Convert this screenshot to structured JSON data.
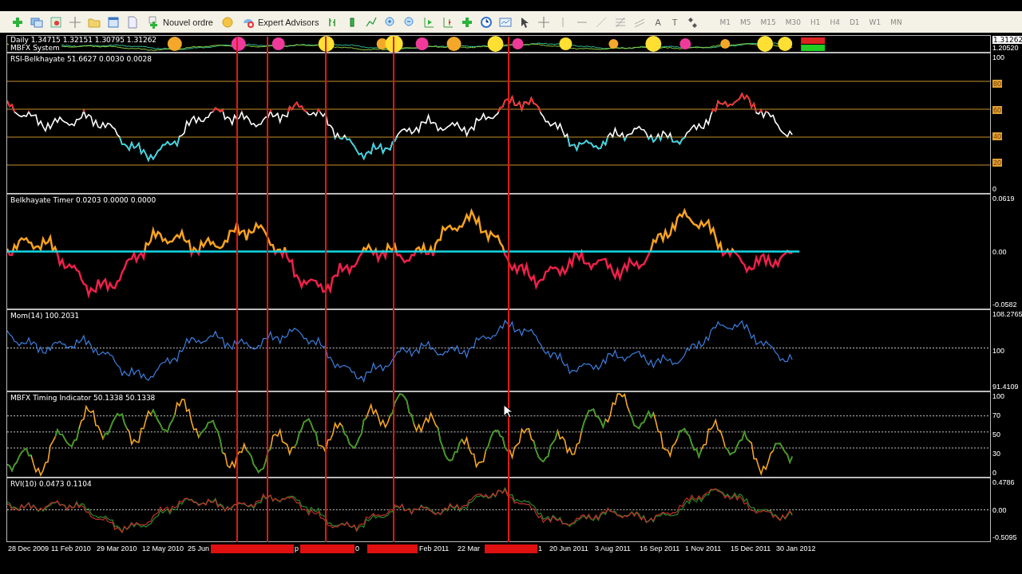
{
  "toolbar": {
    "order_button": "Nouvel ordre",
    "experts_button": "Expert Advisors",
    "text_tools": [
      "A",
      "T"
    ],
    "timeframes": [
      "M1",
      "M5",
      "M15",
      "M30",
      "H1",
      "H4",
      "D1",
      "W1",
      "MN"
    ]
  },
  "chart": {
    "symbol_line": "Daily 1.34715 1.32151 1.30795 1.31262",
    "main_label": "MBFX System",
    "price_current": "1.31262",
    "price_low": "1.20520",
    "panes": [
      {
        "kind": "rsi",
        "label": "RSI-Belkhayate 51.6627 0.0030 0.0028",
        "axis": [
          {
            "text": "100",
            "highlighted": false
          },
          {
            "text": "80",
            "highlighted": true
          },
          {
            "text": "60",
            "highlighted": true
          },
          {
            "text": "40",
            "highlighted": true
          },
          {
            "text": "20",
            "highlighted": true
          },
          {
            "text": "0",
            "highlighted": false
          }
        ]
      },
      {
        "kind": "timer",
        "label": "Belkhayate Timer 0.0203 0.0000 0.0000",
        "axis": [
          {
            "text": "0.0619",
            "highlighted": false
          },
          {
            "text": "0.00",
            "highlighted": false
          },
          {
            "text": "-0.0582",
            "highlighted": false
          }
        ]
      },
      {
        "kind": "momentum",
        "label": "Mom(14) 100.2031",
        "axis": [
          {
            "text": "108.2765",
            "highlighted": false
          },
          {
            "text": "100",
            "highlighted": false
          },
          {
            "text": "91.4109",
            "highlighted": false
          }
        ]
      },
      {
        "kind": "timing",
        "label": "MBFX Timing Indicator 50.1338 50.1338",
        "axis": [
          {
            "text": "100",
            "highlighted": false
          },
          {
            "text": "70",
            "highlighted": false
          },
          {
            "text": "50",
            "highlighted": false
          },
          {
            "text": "30",
            "highlighted": false
          },
          {
            "text": "0",
            "highlighted": false
          }
        ]
      },
      {
        "kind": "rvi",
        "label": "RVI(10) 0.0473 0.1104",
        "axis": [
          {
            "text": "0.4786",
            "highlighted": false
          },
          {
            "text": "0.00",
            "highlighted": false
          },
          {
            "text": "-0.5095",
            "highlighted": false
          }
        ]
      }
    ],
    "time_axis": [
      {
        "kind": "label",
        "text": "28 Dec 2009"
      },
      {
        "kind": "label",
        "text": "11 Feb 2010"
      },
      {
        "kind": "label",
        "text": "29 Mar 2010"
      },
      {
        "kind": "label",
        "text": "12 May 2010"
      },
      {
        "kind": "label",
        "text": "25 Jun"
      },
      {
        "kind": "flag"
      },
      {
        "kind": "label",
        "text": "p"
      },
      {
        "kind": "flag"
      },
      {
        "kind": "label",
        "text": "0"
      },
      {
        "kind": "flag"
      },
      {
        "kind": "label",
        "text": "Feb 2011"
      },
      {
        "kind": "label",
        "text": "22 Mar"
      },
      {
        "kind": "flag"
      },
      {
        "kind": "label",
        "text": "1"
      },
      {
        "kind": "label",
        "text": "20 Jun 2011"
      },
      {
        "kind": "label",
        "text": "3 Aug 2011"
      },
      {
        "kind": "label",
        "text": "16 Sep 2011"
      },
      {
        "kind": "label",
        "text": "1 Nov 2011"
      },
      {
        "kind": "label",
        "text": "15 Dec 2011"
      },
      {
        "kind": "label",
        "text": "30 Jan 2012"
      }
    ]
  }
}
